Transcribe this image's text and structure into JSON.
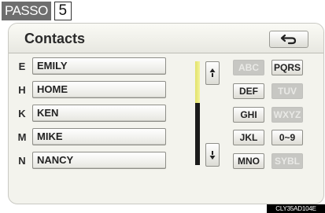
{
  "step": {
    "name": "PASSO",
    "number": "5"
  },
  "header": {
    "title": "Contacts"
  },
  "contacts": [
    {
      "letter": "E",
      "name": "EMILY"
    },
    {
      "letter": "H",
      "name": "HOME"
    },
    {
      "letter": "K",
      "name": "KEN"
    },
    {
      "letter": "M",
      "name": "MIKE"
    },
    {
      "letter": "N",
      "name": "NANCY"
    }
  ],
  "keys": [
    {
      "label": "ABC",
      "enabled": false
    },
    {
      "label": "PQRS",
      "enabled": true
    },
    {
      "label": "DEF",
      "enabled": true
    },
    {
      "label": "TUV",
      "enabled": false
    },
    {
      "label": "GHI",
      "enabled": true
    },
    {
      "label": "WXYZ",
      "enabled": false
    },
    {
      "label": "JKL",
      "enabled": true
    },
    {
      "label": "0~9",
      "enabled": true
    },
    {
      "label": "MNO",
      "enabled": true
    },
    {
      "label": "SYBL",
      "enabled": false
    }
  ],
  "scroll": {
    "position": 0,
    "visible_fraction": 0.4
  },
  "icons": {
    "back": "return-arrow-icon",
    "up": "scroll-up-icon",
    "down": "scroll-down-icon"
  },
  "colors": {
    "scroll_thumb": "#eded8a",
    "disabled_key": "#c7c7c3"
  },
  "figure_code": "CLY35AD104E"
}
